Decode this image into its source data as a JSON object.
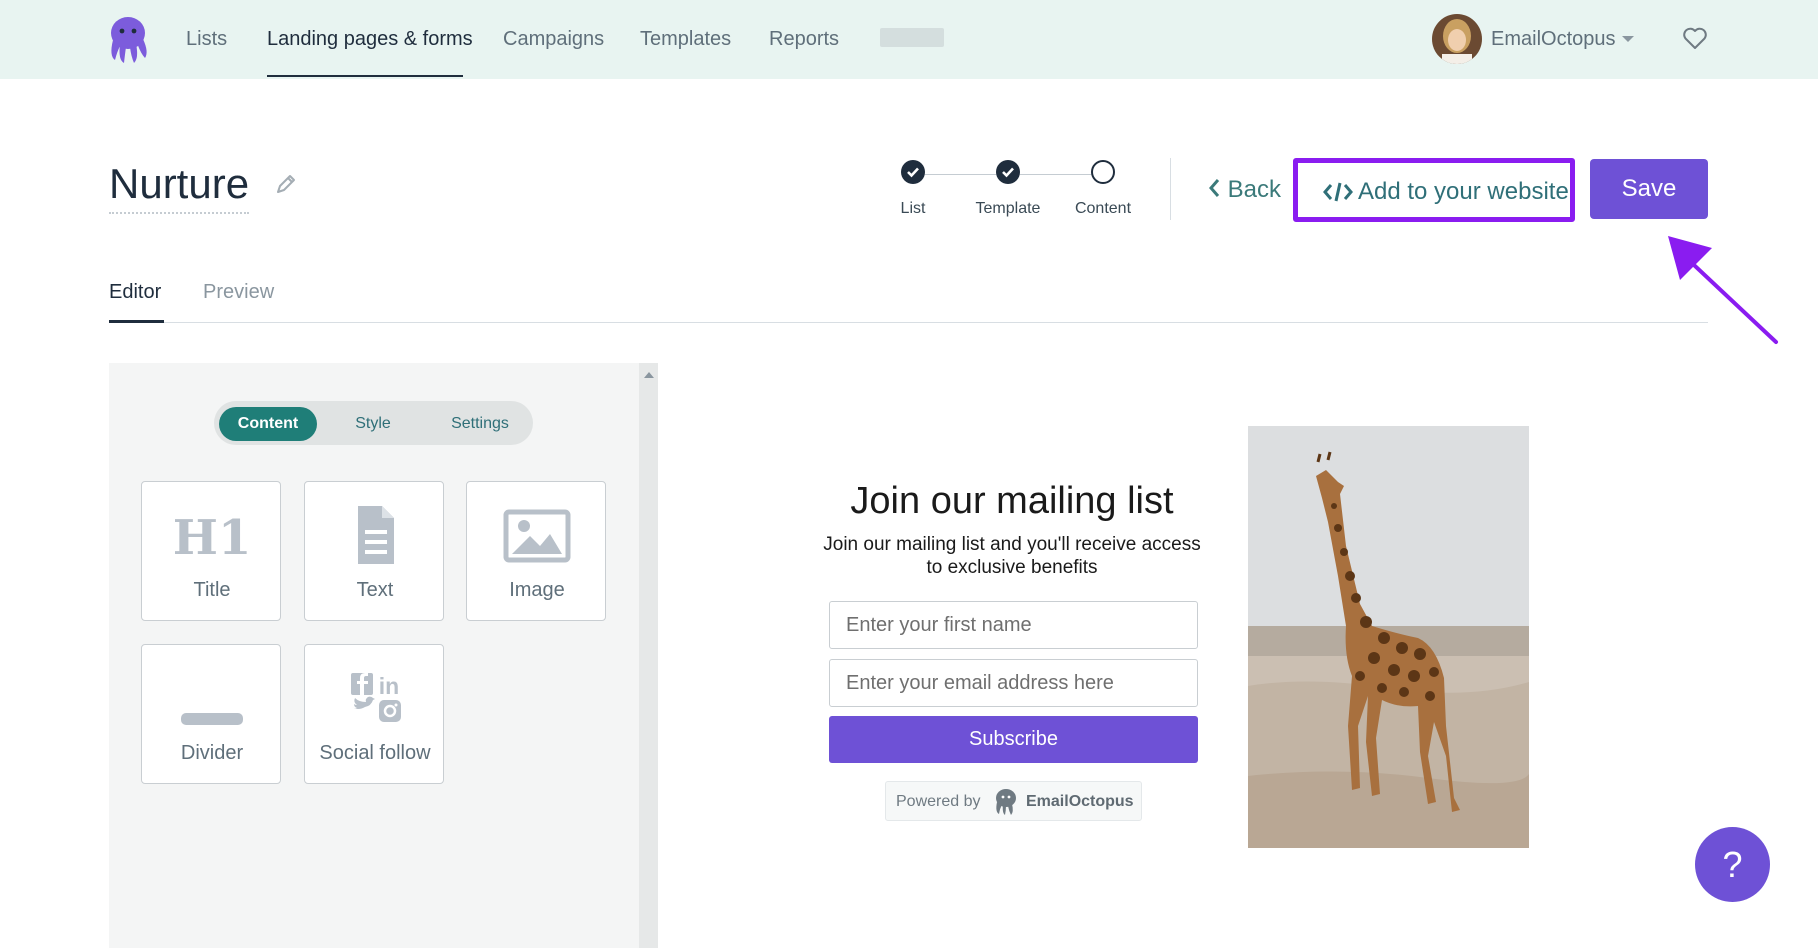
{
  "nav": {
    "items": [
      "Lists",
      "Landing pages & forms",
      "Campaigns",
      "Templates",
      "Reports"
    ],
    "active": "Landing pages & forms",
    "account_name": "EmailOctopus"
  },
  "header": {
    "title": "Nurture",
    "steps": [
      {
        "label": "List",
        "done": true
      },
      {
        "label": "Template",
        "done": true
      },
      {
        "label": "Content",
        "done": false
      }
    ],
    "back_label": "Back",
    "add_to_website_label": "Add to your website",
    "save_label": "Save"
  },
  "tabs": {
    "editor": "Editor",
    "preview": "Preview",
    "active": "Editor"
  },
  "panel": {
    "segments": [
      "Content",
      "Style",
      "Settings"
    ],
    "active_segment": "Content",
    "blocks": [
      {
        "label": "Title",
        "icon": "h1-icon"
      },
      {
        "label": "Text",
        "icon": "document-icon"
      },
      {
        "label": "Image",
        "icon": "image-icon"
      },
      {
        "label": "Divider",
        "icon": "divider-icon"
      },
      {
        "label": "Social follow",
        "icon": "social-icons"
      }
    ],
    "h1_glyph": "H1"
  },
  "preview": {
    "title": "Join our mailing list",
    "description": "Join our mailing list and you'll receive access to exclusive benefits",
    "first_name_placeholder": "Enter your first name",
    "email_placeholder": "Enter your email address here",
    "subscribe_label": "Subscribe",
    "powered_by": "Powered by",
    "brand": "EmailOctopus"
  },
  "help_label": "?",
  "colors": {
    "nav_bg": "#e8f4f1",
    "accent_purple": "#6e51d6",
    "highlight_purple": "#8a1cf0",
    "teal": "#1f7e78",
    "text_dark": "#1f2d3d"
  }
}
